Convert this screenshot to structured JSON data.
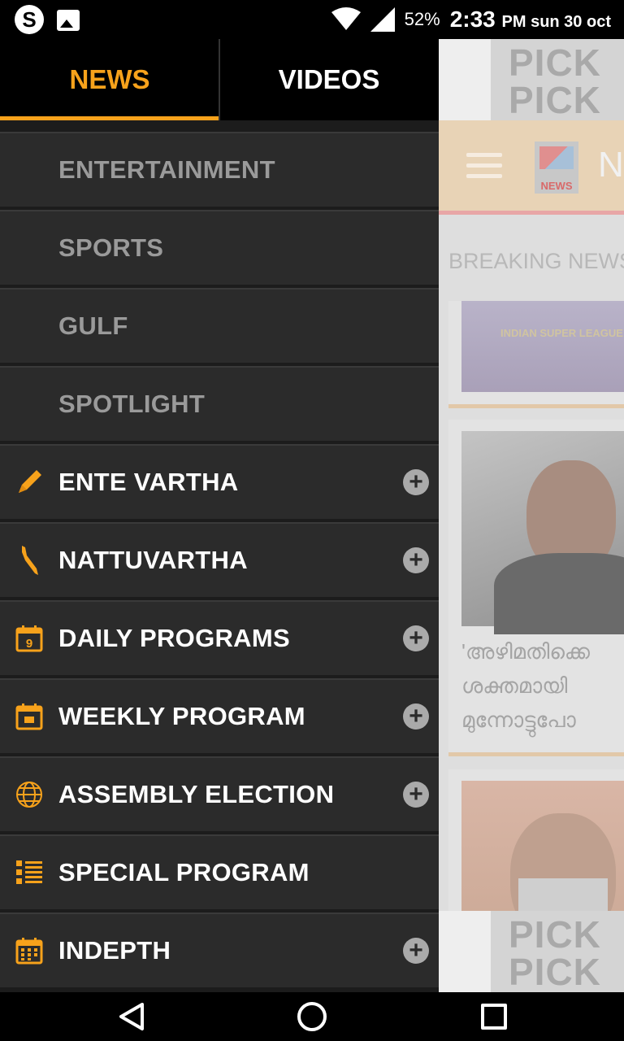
{
  "status_bar": {
    "battery": "52%",
    "time": "2:33",
    "time_suffix": "PM sun 30 oct"
  },
  "drawer": {
    "tabs": [
      {
        "label": "NEWS",
        "active": true
      },
      {
        "label": "VIDEOS",
        "active": false
      }
    ],
    "items": [
      {
        "label": "ENTERTAINMENT",
        "icon": "none",
        "expandable": false
      },
      {
        "label": "SPORTS",
        "icon": "none",
        "expandable": false
      },
      {
        "label": "GULF",
        "icon": "none",
        "expandable": false
      },
      {
        "label": "SPOTLIGHT",
        "icon": "none",
        "expandable": false
      },
      {
        "label": "ENTE VARTHA",
        "icon": "pencil-icon",
        "expandable": true
      },
      {
        "label": "NATTUVARTHA",
        "icon": "kerala-map-icon",
        "expandable": true
      },
      {
        "label": "DAILY PROGRAMS",
        "icon": "calendar-day-icon",
        "expandable": true
      },
      {
        "label": "WEEKLY PROGRAM",
        "icon": "calendar-week-icon",
        "expandable": true
      },
      {
        "label": "ASSEMBLY ELECTION",
        "icon": "globe-icon",
        "expandable": true
      },
      {
        "label": "SPECIAL PROGRAM",
        "icon": "list-icon",
        "expandable": false
      },
      {
        "label": "INDEPTH",
        "icon": "calendar-grid-icon",
        "expandable": true
      }
    ],
    "accent_color": "#f7a21b"
  },
  "background_app": {
    "ad_text_line1": "PICK",
    "ad_text_line2": "PICK A",
    "logo_text": "NEWS",
    "header_initial": "N",
    "breaking_label": "BREAKING NEWS",
    "card1_caption": "INDIAN SUPER LEAGUE",
    "card2_text": [
      "'അഴിമതിക്കെ",
      "ശക്തമായി",
      "മുന്നോട്ടുപോ"
    ]
  }
}
